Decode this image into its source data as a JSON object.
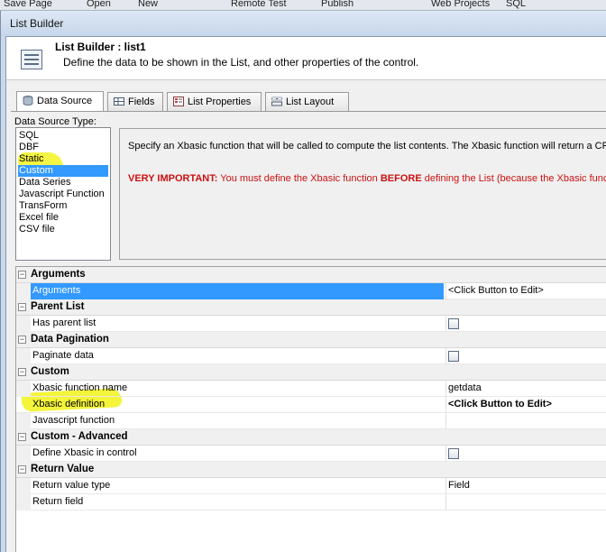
{
  "taskbar": {
    "items": [
      "Save Page",
      "Open",
      "New",
      "",
      "Remote Test",
      "Publish",
      "Web Projects",
      "SQL"
    ]
  },
  "window": {
    "title": "List Builder"
  },
  "header": {
    "title": "List Builder : list1",
    "description": "Define the data to be shown in the List, and other properties of the control."
  },
  "tabs": [
    {
      "label": "Data Source",
      "icon": "database-icon",
      "active": true
    },
    {
      "label": "Fields",
      "icon": "fields-icon",
      "active": false
    },
    {
      "label": "List Properties",
      "icon": "properties-icon",
      "active": false
    },
    {
      "label": "List Layout",
      "icon": "layout-icon",
      "active": false
    }
  ],
  "data_source": {
    "label": "Data Source Type:",
    "items": [
      "SQL",
      "DBF",
      "Static",
      "Custom",
      "Data Series",
      "Javascript Function",
      "TransForm",
      "Excel file",
      "CSV file"
    ],
    "selected": "Custom"
  },
  "description_panel": {
    "line1": "Specify an Xbasic function that will be called to compute the list contents. The Xbasic function will return a CR-L",
    "important_prefix": "VERY IMPORTANT:",
    "important_mid": " You must define the Xbasic function ",
    "important_bold": "BEFORE",
    "important_suffix": " defining the List (because the Xbasic functio"
  },
  "grid": {
    "categories": {
      "arguments": "Arguments",
      "parent_list": "Parent List",
      "data_pagination": "Data Pagination",
      "custom": "Custom",
      "custom_advanced": "Custom - Advanced",
      "return_value": "Return Value"
    },
    "props": {
      "arguments": {
        "name": "Arguments",
        "value": "<Click Button to Edit>"
      },
      "has_parent_list": {
        "name": "Has parent list"
      },
      "paginate_data": {
        "name": "Paginate data"
      },
      "xbasic_function_name": {
        "name": "Xbasic function name",
        "value": "getdata"
      },
      "xbasic_definition": {
        "name": "Xbasic definition",
        "value": "<Click Button to Edit>"
      },
      "javascript_function": {
        "name": "Javascript function",
        "value": ""
      },
      "define_xbasic_in_control": {
        "name": "Define Xbasic in control"
      },
      "return_value_type": {
        "name": "Return value type",
        "value": "Field"
      },
      "return_field": {
        "name": "Return field",
        "value": ""
      }
    },
    "toggle_glyph": "−"
  },
  "colors": {
    "selection": "#3399ff",
    "important": "#cc1111",
    "highlighter": "#f4f43a"
  }
}
